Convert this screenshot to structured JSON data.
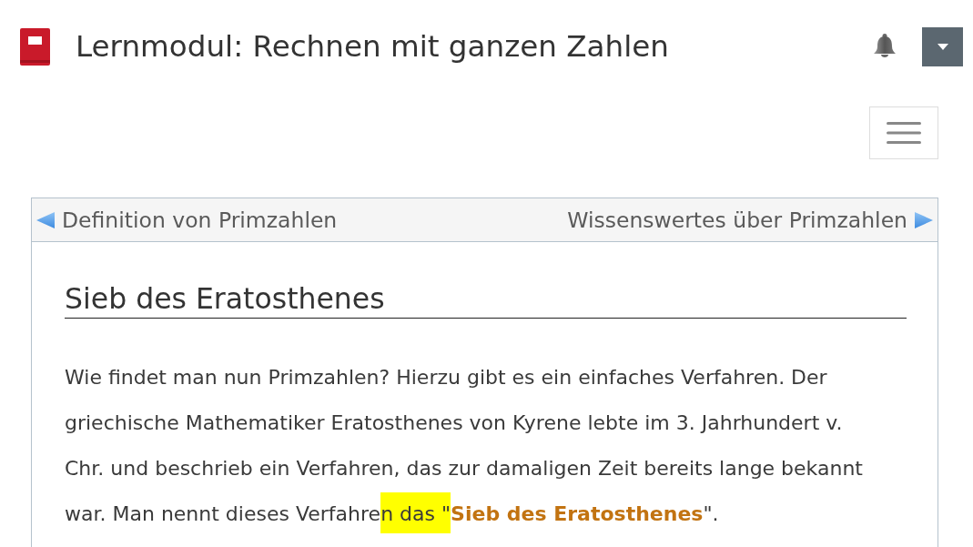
{
  "header": {
    "title": "Lernmodul: Rechnen mit ganzen Zahlen"
  },
  "navigation": {
    "previous": "Definition von Primzahlen",
    "next": "Wissenswertes über Primzahlen"
  },
  "content": {
    "heading": "Sieb des Eratosthenes",
    "paragraph": [
      {
        "kind": "text",
        "text": "Wie findet man nun Primzahlen? Hierzu gibt es ein einfaches Verfahren. Der griechische Mathematiker Eratosthenes von Kyrene lebte im 3. Jahrhundert v. Chr. und beschrieb ein Verfahren, das zur damaligen Zeit bereits lange bekannt war. Man nennt dieses Verfahre",
        "highlighted": false
      },
      {
        "kind": "text",
        "text": "n das \"",
        "highlighted": true
      },
      {
        "kind": "link",
        "text": "Sieb des Eratosthenes",
        "highlighted": false
      },
      {
        "kind": "text",
        "text": "\".",
        "highlighted": false
      }
    ]
  }
}
